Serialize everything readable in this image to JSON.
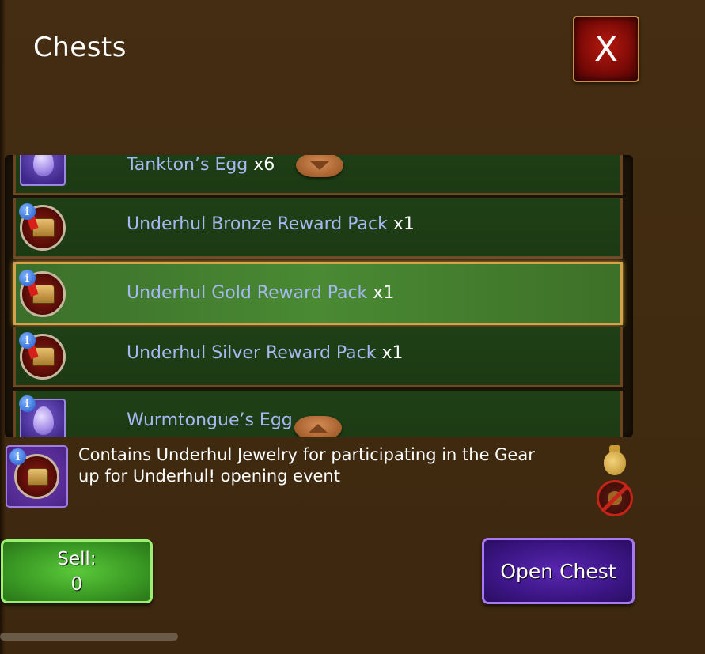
{
  "header": {
    "title": "Chests",
    "close_label": "X"
  },
  "chest_list": {
    "items": [
      {
        "name": "Tankton’s Egg",
        "qty": "x6",
        "icon": "egg-icon"
      },
      {
        "name": "Underhul Bronze Reward Pack",
        "qty": "x1",
        "icon": "reward-pack-icon"
      },
      {
        "name": "Underhul Gold Reward Pack",
        "qty": "x1",
        "icon": "reward-pack-icon",
        "selected": true
      },
      {
        "name": "Underhul Silver Reward Pack",
        "qty": "x1",
        "icon": "reward-pack-icon"
      },
      {
        "name": "Wurmtongue’s Egg",
        "qty": "",
        "icon": "egg-icon"
      }
    ]
  },
  "details": {
    "description": "Contains Underhul Jewelry for participating in the Gear up for Underhul! opening event"
  },
  "actions": {
    "sell_label": "Sell:",
    "sell_value": "0",
    "open_label": "Open Chest"
  },
  "colors": {
    "background": "#3f2a10",
    "row_green": "#1f4016",
    "selected_border": "#d4a24a",
    "label_blue": "#a6b8f2",
    "sell_green": "#3a9a24",
    "open_purple": "#3c1686",
    "close_red": "#7a0a06"
  }
}
